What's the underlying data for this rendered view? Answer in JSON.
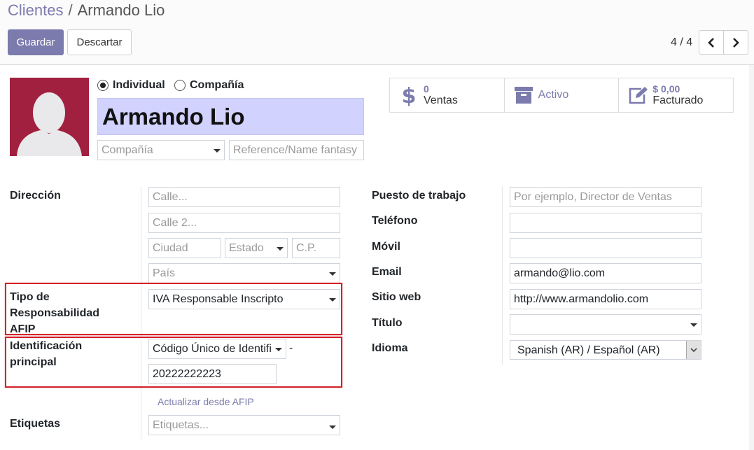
{
  "breadcrumb": {
    "parent": "Clientes",
    "separator": "/",
    "current": "Armando Lio"
  },
  "toolbar": {
    "save_label": "Guardar",
    "discard_label": "Descartar"
  },
  "pager": {
    "value": "4 / 4"
  },
  "partner": {
    "type_individual": "Individual",
    "type_company": "Compañía",
    "name": "Armando Lio",
    "company_placeholder": "Compañía",
    "reference_placeholder": "Reference/Name fantasy"
  },
  "stats": [
    {
      "icon": "dollar-icon",
      "number": "0",
      "label": "Ventas"
    },
    {
      "icon": "archive-icon",
      "number": "",
      "label": "Activo"
    },
    {
      "icon": "edit-icon",
      "number": "$ 0,00",
      "label": "Facturado"
    }
  ],
  "address": {
    "label": "Dirección",
    "street_placeholder": "Calle...",
    "street2_placeholder": "Calle 2...",
    "city_placeholder": "Ciudad",
    "state_placeholder": "Estado",
    "zip_placeholder": "C.P.",
    "country_placeholder": "País"
  },
  "afip": {
    "label_line1": "Tipo de",
    "label_line2": "Responsabilidad",
    "label_line3": "AFIP",
    "value": "IVA Responsable Inscripto"
  },
  "identification": {
    "label_line1": "Identificación",
    "label_line2": "principal",
    "type_value": "Código Único de Identifi",
    "dash": "-",
    "number_value": "20222222223",
    "update_link": "Actualizar desde AFIP"
  },
  "tags": {
    "label": "Etiquetas",
    "placeholder": "Etiquetas..."
  },
  "right_fields": {
    "job_label": "Puesto de trabajo",
    "job_placeholder": "Por ejemplo, Director de Ventas",
    "phone_label": "Teléfono",
    "mobile_label": "Móvil",
    "email_label": "Email",
    "email_value": "armando@lio.com",
    "website_label": "Sitio web",
    "website_value": "http://www.armandolio.com",
    "title_label": "Título",
    "language_label": "Idioma",
    "language_value": "Spanish (AR) / Español (AR)"
  },
  "colors": {
    "accent": "#7c7bad",
    "avatar_bg": "#a2203f",
    "name_bg": "#d2d2ff",
    "highlight": "#d2232a"
  }
}
